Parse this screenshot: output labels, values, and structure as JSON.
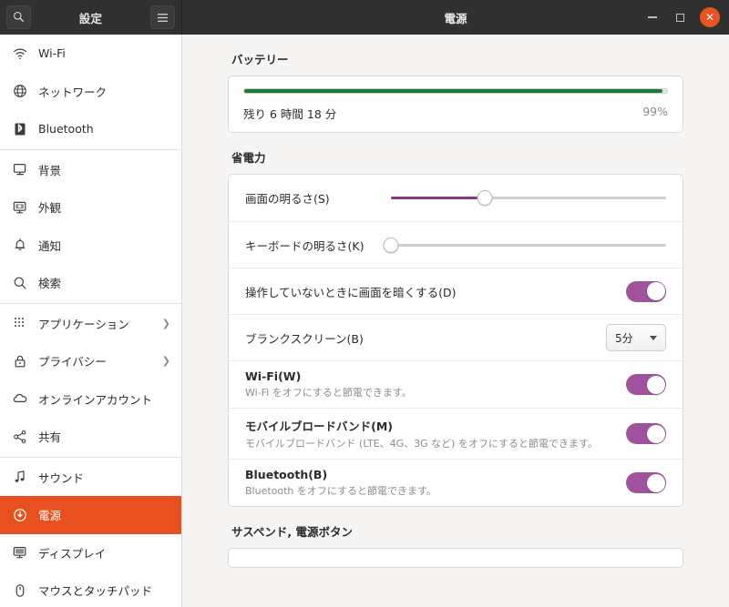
{
  "titlebar": {
    "app_title": "設定",
    "page_title": "電源",
    "search_icon": "search-icon",
    "menu_icon": "hamburger-menu-icon",
    "minimize_label": "",
    "maximize_label": "",
    "close_label": "✕"
  },
  "sidebar": {
    "items": [
      {
        "label": "Wi-Fi",
        "icon": "wifi-icon",
        "chevron": "",
        "selected": false
      },
      {
        "label": "ネットワーク",
        "icon": "network-globe-icon",
        "chevron": "",
        "selected": false
      },
      {
        "label": "Bluetooth",
        "icon": "bluetooth-icon",
        "chevron": "",
        "selected": false
      },
      {
        "label": "背景",
        "icon": "background-monitor-icon",
        "chevron": "",
        "selected": false
      },
      {
        "label": "外観",
        "icon": "appearance-icon",
        "chevron": "",
        "selected": false
      },
      {
        "label": "通知",
        "icon": "bell-icon",
        "chevron": "",
        "selected": false
      },
      {
        "label": "検索",
        "icon": "search-icon",
        "chevron": "",
        "selected": false
      },
      {
        "label": "アプリケーション",
        "icon": "apps-grid-icon",
        "chevron": "❯",
        "selected": false
      },
      {
        "label": "プライバシー",
        "icon": "lock-icon",
        "chevron": "❯",
        "selected": false
      },
      {
        "label": "オンラインアカウント",
        "icon": "cloud-icon",
        "chevron": "",
        "selected": false
      },
      {
        "label": "共有",
        "icon": "share-icon",
        "chevron": "",
        "selected": false
      },
      {
        "label": "サウンド",
        "icon": "music-note-icon",
        "chevron": "",
        "selected": false
      },
      {
        "label": "電源",
        "icon": "power-icon",
        "chevron": "",
        "selected": true
      },
      {
        "label": "ディスプレイ",
        "icon": "display-icon",
        "chevron": "",
        "selected": false
      },
      {
        "label": "マウスとタッチパッド",
        "icon": "mouse-icon",
        "chevron": "",
        "selected": false
      }
    ],
    "separators_after": [
      2,
      6,
      10,
      11
    ]
  },
  "battery": {
    "section_title": "バッテリー",
    "time_remaining": "残り 6 時間 18 分",
    "percent_label": "99%",
    "percent_value": 99,
    "bar_color": "#1d7a34"
  },
  "power_saving": {
    "section_title": "省電力",
    "screen_brightness": {
      "label": "画面の明るさ(S)",
      "value": 34
    },
    "keyboard_brightness": {
      "label": "キーボードの明るさ(K)",
      "value": 0
    },
    "dim_screen": {
      "label": "操作していないときに画面を暗くする(D)",
      "state": "on"
    },
    "blank_screen": {
      "label": "ブランクスクリーン(B)",
      "value": "5分"
    },
    "wifi": {
      "title": "Wi-Fi(W)",
      "subtitle": "Wi-Fi をオフにすると節電できます。",
      "state": "on"
    },
    "mobile_broadband": {
      "title": "モバイルブロードバンド(M)",
      "subtitle": "モバイルブロードバンド (LTE、4G、3G など) をオフにすると節電できます。",
      "state": "on"
    },
    "bluetooth": {
      "title": "Bluetooth(B)",
      "subtitle": "Bluetooth をオフにすると節電できます。",
      "state": "on"
    }
  },
  "suspend": {
    "section_title": "サスペンド, 電源ボタン"
  },
  "colors": {
    "accent_orange": "#e8511f",
    "toggle_purple": "#a0529c",
    "slider_purple": "#8b348b",
    "battery_green": "#1d7a34"
  }
}
